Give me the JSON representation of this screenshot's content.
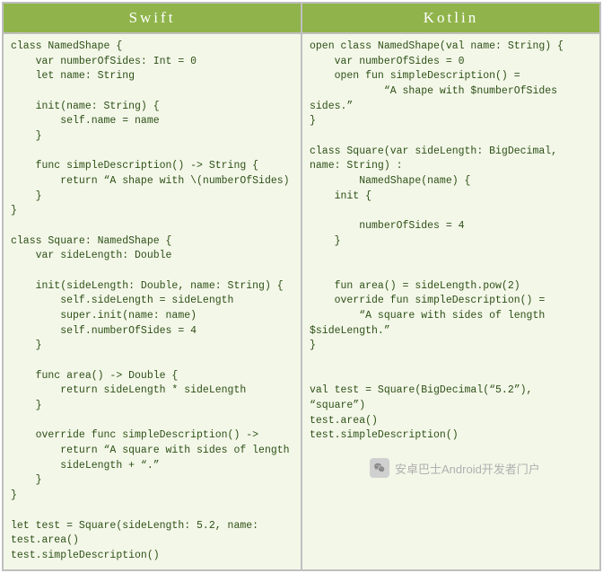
{
  "headers": {
    "left": "Swift",
    "right": "Kotlin"
  },
  "code": {
    "swift": "class NamedShape {\n    var numberOfSides: Int = 0\n    let name: String\n\n    init(name: String) {\n        self.name = name\n    }\n\n    func simpleDescription() -> String {\n        return “A shape with \\(numberOfSides)\n    }\n}\n\nclass Square: NamedShape {\n    var sideLength: Double\n\n    init(sideLength: Double, name: String) {\n        self.sideLength = sideLength\n        super.init(name: name)\n        self.numberOfSides = 4\n    }\n\n    func area() -> Double {\n        return sideLength * sideLength\n    }\n\n    override func simpleDescription() ->\n        return “A square with sides of length\n        sideLength + “.”\n    }\n}\n\nlet test = Square(sideLength: 5.2, name:\ntest.area()\ntest.simpleDescription()",
    "kotlin": "open class NamedShape(val name: String) {\n    var numberOfSides = 0\n    open fun simpleDescription() =\n            “A shape with $numberOfSides\nsides.”\n}\n\nclass Square(var sideLength: BigDecimal,\nname: String) :\n        NamedShape(name) {\n    init {\n\n        numberOfSides = 4\n    }\n\n\n    fun area() = sideLength.pow(2)\n    override fun simpleDescription() =\n        “A square with sides of length\n$sideLength.”\n}\n\n\nval test = Square(BigDecimal(“5.2”),\n“square”)\ntest.area()\ntest.simpleDescription()"
  },
  "watermark": {
    "text": "安卓巴士Android开发者门户"
  }
}
